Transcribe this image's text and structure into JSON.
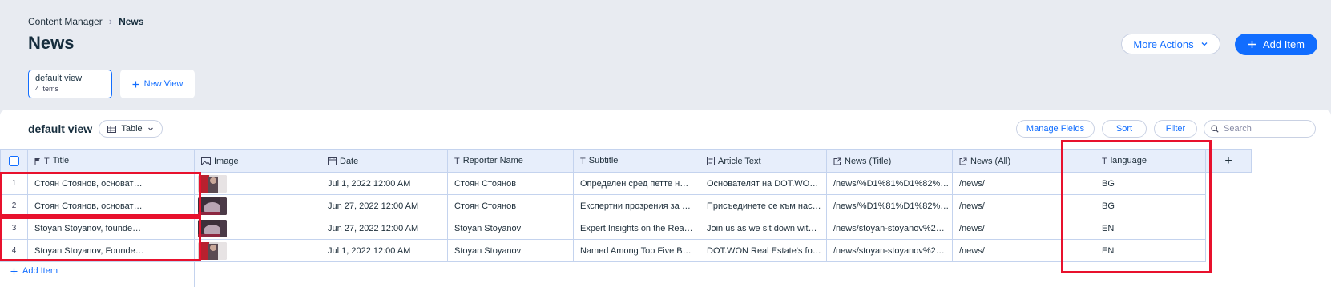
{
  "breadcrumb": {
    "parent": "Content Manager",
    "current": "News"
  },
  "page": {
    "title": "News"
  },
  "actions": {
    "more_actions": "More Actions",
    "add_item": "Add Item"
  },
  "views": {
    "active_name": "default view",
    "active_count": "4 items",
    "new_view": "New View"
  },
  "panel": {
    "title": "default view",
    "layout": "Table",
    "manage_fields": "Manage Fields",
    "sort": "Sort",
    "filter": "Filter",
    "search_placeholder": "Search"
  },
  "columns": {
    "title": "Title",
    "image": "Image",
    "date": "Date",
    "reporter": "Reporter Name",
    "subtitle": "Subtitle",
    "article": "Article Text",
    "news_title": "News (Title)",
    "news_all": "News (All)",
    "language": "language"
  },
  "rows": [
    {
      "index": "1",
      "title": "Стоян Стоянов, основат…",
      "date": "Jul 1, 2022 12:00 AM",
      "reporter": "Стоян Стоянов",
      "subtitle": "Определен сред петте н…",
      "article": "Основателят на DOT.WO…",
      "news_title": "/news/%D1%81%D1%82%…",
      "news_all": "/news/",
      "language": "BG"
    },
    {
      "index": "2",
      "title": "Стоян Стоянов, основат…",
      "date": "Jun 27, 2022 12:00 AM",
      "reporter": "Стоян Стоянов",
      "subtitle": "Експертни прозрения за …",
      "article": "Присъединете се към нас…",
      "news_title": "/news/%D1%81%D1%82%…",
      "news_all": "/news/",
      "language": "BG"
    },
    {
      "index": "3",
      "title": "Stoyan Stoyanov, founde…",
      "date": "Jun 27, 2022 12:00 AM",
      "reporter": "Stoyan Stoyanov",
      "subtitle": "Expert Insights on the Rea…",
      "article": "Join us as we sit down wit…",
      "news_title": "/news/stoyan-stoyanov%2…",
      "news_all": "/news/",
      "language": "EN"
    },
    {
      "index": "4",
      "title": "Stoyan Stoyanov, Founde…",
      "date": "Jul 1, 2022 12:00 AM",
      "reporter": "Stoyan Stoyanov",
      "subtitle": "Named Among Top Five B…",
      "article": "DOT.WON Real Estate's fo…",
      "news_title": "/news/stoyan-stoyanov%2…",
      "news_all": "/news/",
      "language": "EN"
    }
  ],
  "footer": {
    "add_item": "Add Item"
  },
  "colors": {
    "accent": "#116dff",
    "highlight": "#e8112d",
    "header_bg": "#e7eefb"
  }
}
